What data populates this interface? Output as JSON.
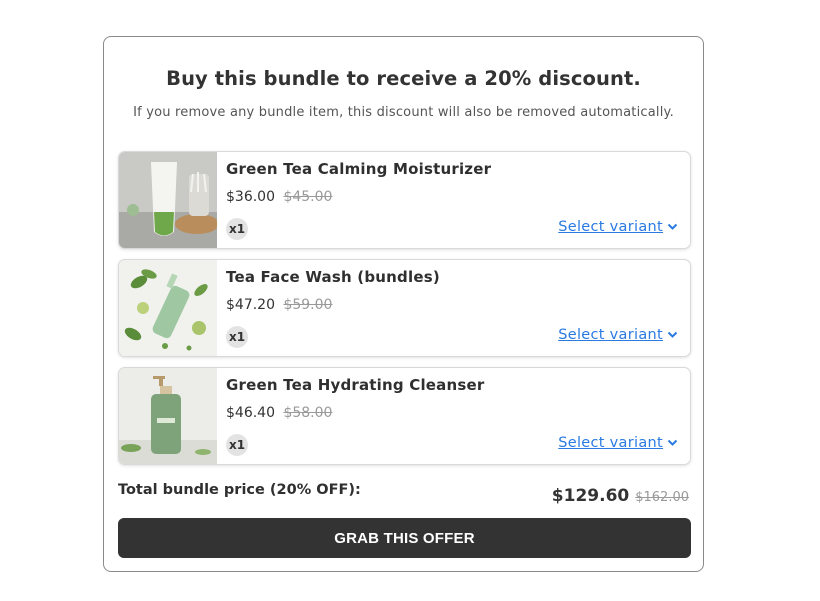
{
  "bundle": {
    "title": "Buy this bundle to receive a 20% discount.",
    "subtitle": "If you remove any bundle item, this discount will also be removed automatically.",
    "items": [
      {
        "name": "Green Tea Calming Moisturizer",
        "price": "$36.00",
        "original_price": "$45.00",
        "quantity": "x1",
        "variant_label": "Select variant"
      },
      {
        "name": "Tea Face Wash (bundles)",
        "price": "$47.20",
        "original_price": "$59.00",
        "quantity": "x1",
        "variant_label": "Select variant"
      },
      {
        "name": "Green Tea Hydrating Cleanser",
        "price": "$46.40",
        "original_price": "$58.00",
        "quantity": "x1",
        "variant_label": "Select variant"
      }
    ],
    "total_label": "Total bundle price (20% OFF):",
    "total_price": "$129.60",
    "total_original_price": "$162.00",
    "cta_label": "GRAB THIS OFFER"
  },
  "colors": {
    "accent_link": "#2a7ae2",
    "button_bg": "#333333",
    "card_border": "#8a8a8a"
  },
  "icons": [
    "chevron-down-icon"
  ]
}
